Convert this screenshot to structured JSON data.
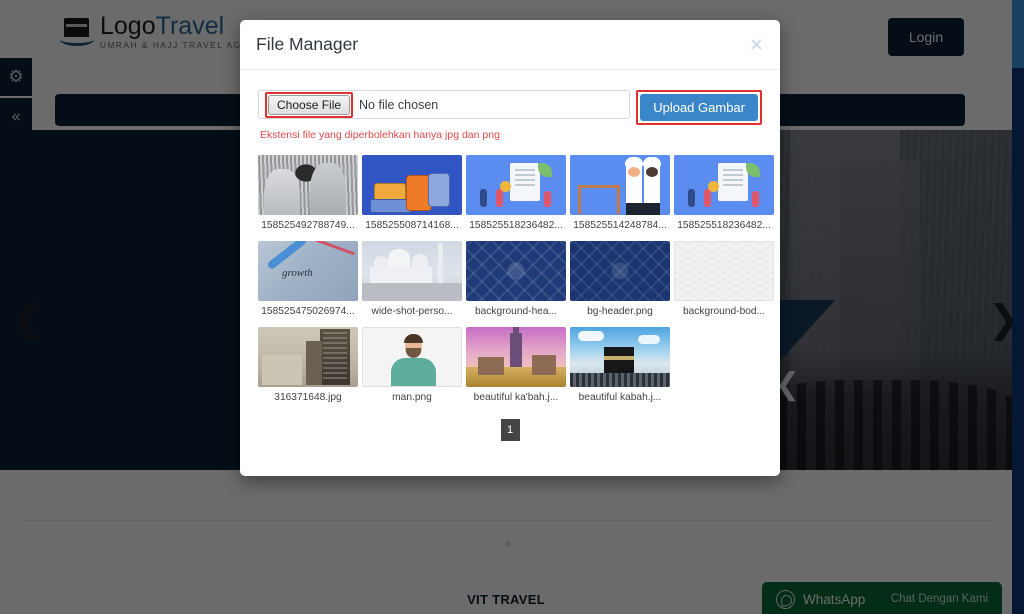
{
  "site": {
    "logo": {
      "text_main_1": "Logo",
      "text_main_2": "Travel",
      "tagline": "UMRAH & HAJJ TRAVEL AGENT"
    },
    "login_label": "Login",
    "side_toolbar": [
      {
        "name": "settings-gears-icon",
        "glyph": "⚙"
      },
      {
        "name": "collapse-left-icon",
        "glyph": "«"
      }
    ],
    "carousel": {
      "prev_glyph": "❮",
      "next_glyph": "❯",
      "inner_glyph": "❮"
    },
    "footer": {
      "title": "VIT TRAVEL",
      "plus_glyph": "+"
    },
    "whatsapp": {
      "label": "WhatsApp",
      "sub": "Chat Dengan Kami"
    }
  },
  "modal": {
    "title": "File Manager",
    "close_glyph": "×",
    "upload": {
      "choose_file_label": "Choose File",
      "no_file_text": "No file chosen",
      "upload_button_label": "Upload Gambar",
      "extension_note": "Ekstensi file yang diperbolehkan hanya jpg dan png"
    },
    "files": [
      {
        "label": "158525492788749...",
        "art": "t-kaaba-crowd"
      },
      {
        "label": "158525508714168...",
        "art": "t-luggage"
      },
      {
        "label": "158525518236482...",
        "art": "t-illus"
      },
      {
        "label": "158525514248784...",
        "art": "t-chef"
      },
      {
        "label": "158525518236482...",
        "art": "t-illus"
      },
      {
        "label": "158525475026974...",
        "art": "t-growth"
      },
      {
        "label": "wide-shot-perso...",
        "art": "t-mosque"
      },
      {
        "label": "background-hea...",
        "art": "t-pattern"
      },
      {
        "label": "bg-header.png",
        "art": "t-pattern2"
      },
      {
        "label": "background-bod...",
        "art": "t-bodybg"
      },
      {
        "label": "316371648.jpg",
        "art": "t-city"
      },
      {
        "label": "man.png",
        "art": "t-man"
      },
      {
        "label": "beautiful ka'bah.j...",
        "art": "t-kabah-pink"
      },
      {
        "label": "beautiful kabah.j...",
        "art": "t-kaaba-blue"
      }
    ],
    "pagination": {
      "current_page": "1"
    }
  },
  "colors": {
    "accent_blue": "#3b86c8",
    "navy": "#0d2236",
    "highlight_red": "#e03131",
    "note_red": "#e04a4a",
    "whatsapp_green": "#0b6b3a",
    "page_btn": "#454545"
  }
}
